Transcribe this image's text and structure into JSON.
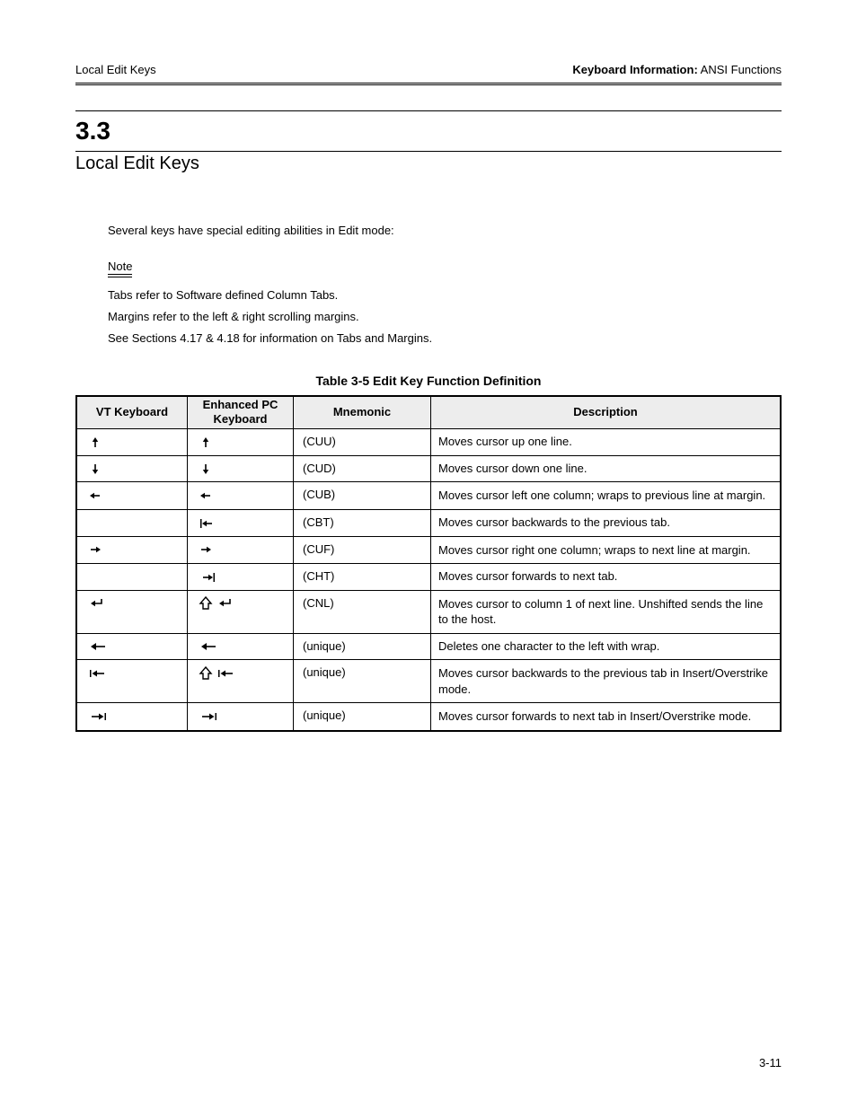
{
  "header": {
    "top_left": "Local Edit Keys",
    "top_right_bold": "Keyboard Information:",
    "top_right_rest": " ANSI Functions",
    "section_number": "3.3",
    "section_title": "Local Edit Keys"
  },
  "intro": {
    "lead": "Several keys have special editing abilities in Edit mode:",
    "note_word": "Note",
    "note_lines": [
      "Tabs refer to Software defined Column Tabs.",
      "Margins refer to the left & right scrolling margins.",
      "See Sections 4.17 & 4.18 for information on Tabs and Margins."
    ]
  },
  "table": {
    "title": "Table 3-5 Edit Key Function Definition",
    "headers": {
      "vt_keyboard": "VT Keyboard",
      "pc_keyboard": "Enhanced PC Keyboard",
      "mnemonic": "Mnemonic",
      "description": "Description"
    },
    "rows": [
      {
        "vt": "up",
        "pc": "up",
        "mnemonic": "(CUU)",
        "desc": "Moves cursor up one line."
      },
      {
        "vt": "down",
        "pc": "down",
        "mnemonic": "(CUD)",
        "desc": "Moves cursor down one line."
      },
      {
        "vt": "left",
        "pc": "left",
        "mnemonic": "(CUB)",
        "desc": "Moves cursor left one column; wraps to previous line at margin."
      },
      {
        "vt": "",
        "pc": "home-left",
        "mnemonic": "(CBT)",
        "desc": "Moves cursor backwards to the previous tab."
      },
      {
        "vt": "right",
        "pc": "right",
        "mnemonic": "(CUF)",
        "desc": "Moves cursor right one column; wraps to next line at margin."
      },
      {
        "vt": "",
        "pc": "end-right",
        "mnemonic": "(CHT)",
        "desc": "Moves cursor forwards to next tab."
      },
      {
        "vt": "return",
        "pc": "shift-return",
        "mnemonic": "(CNL)",
        "desc": "Moves cursor to column 1 of next line. Unshifted sends the line to the host."
      },
      {
        "vt": "backspace",
        "pc": "backspace",
        "mnemonic": "(unique)",
        "desc": "Deletes one character to the left with wrap."
      },
      {
        "vt": "tab-left",
        "pc": "shift-tab-left",
        "mnemonic": "(unique)",
        "desc": "Moves cursor backwards to the previous tab in Insert/Overstrike mode."
      },
      {
        "vt": "tab-right",
        "pc": "tab-right",
        "mnemonic": "(unique)",
        "desc": "Moves cursor forwards to next tab in Insert/Overstrike mode."
      }
    ]
  },
  "footer": {
    "page": "3-11"
  }
}
